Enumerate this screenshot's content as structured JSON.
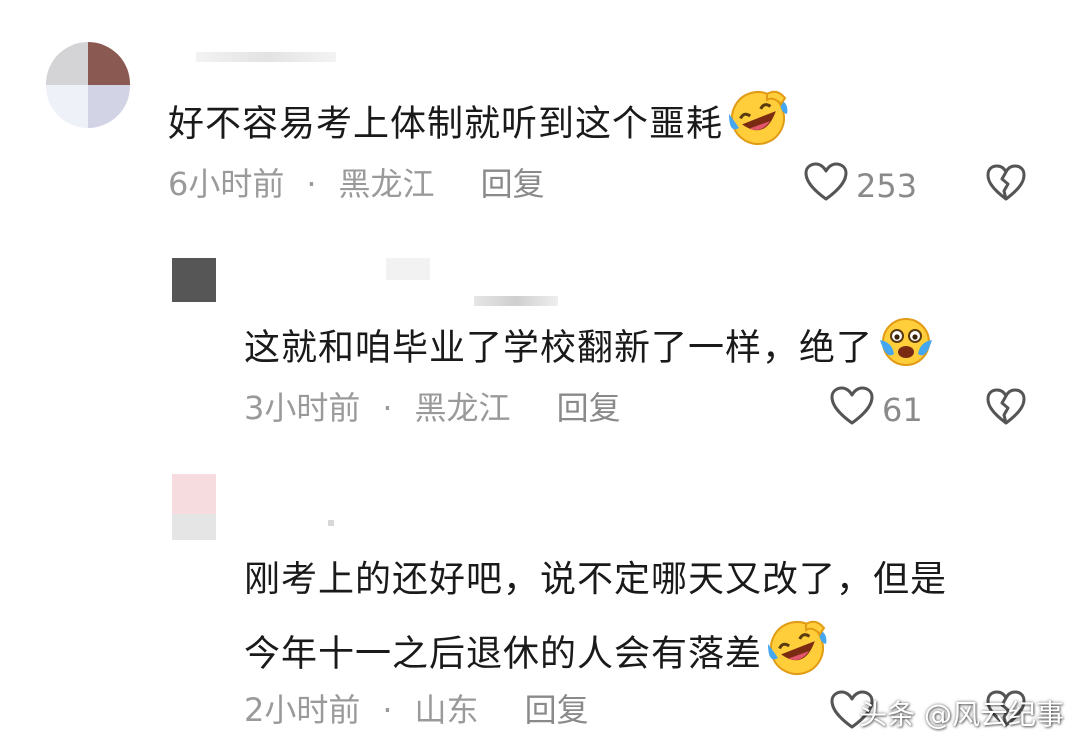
{
  "comments": [
    {
      "text": "好不容易考上体制就听到这个噩耗",
      "emoji": "laughing-tears-emoji",
      "time": "6小时前",
      "separator": "·",
      "location": "黑龙江",
      "reply_label": "回复",
      "likes": "253"
    },
    {
      "text": "这就和咱毕业了学校翻新了一样，绝了",
      "emoji": "crying-laughing-face-emoji",
      "time": "3小时前",
      "separator": "·",
      "location": "黑龙江",
      "reply_label": "回复",
      "likes": "61"
    },
    {
      "text_line1": "刚考上的还好吧，说不定哪天又改了，但是",
      "text_line2": "今年十一之后退休的人会有落差",
      "emoji": "laughing-tears-emoji",
      "time": "2小时前",
      "separator": "·",
      "location": "山东",
      "reply_label": "回复"
    }
  ],
  "watermark": "头条 @风云纪事"
}
